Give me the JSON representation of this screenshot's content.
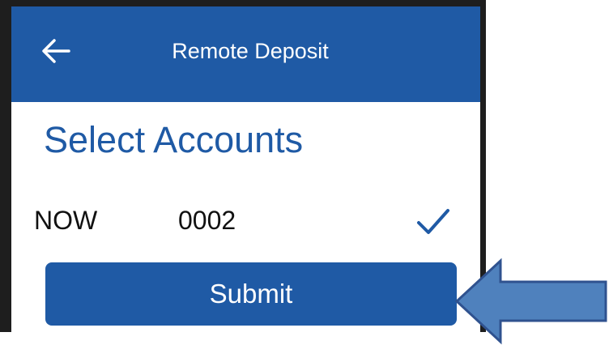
{
  "header": {
    "title": "Remote Deposit",
    "back_icon": "arrow-left-icon"
  },
  "main": {
    "section_title": "Select Accounts",
    "accounts": [
      {
        "type": "NOW",
        "number": "0002",
        "selected": true
      }
    ],
    "submit_label": "Submit"
  },
  "colors": {
    "brand_blue": "#1f5aa5",
    "callout_arrow_fill": "#4f81bd",
    "callout_arrow_stroke": "#2f528f"
  },
  "annotation": {
    "icon": "callout-arrow-left-icon"
  }
}
